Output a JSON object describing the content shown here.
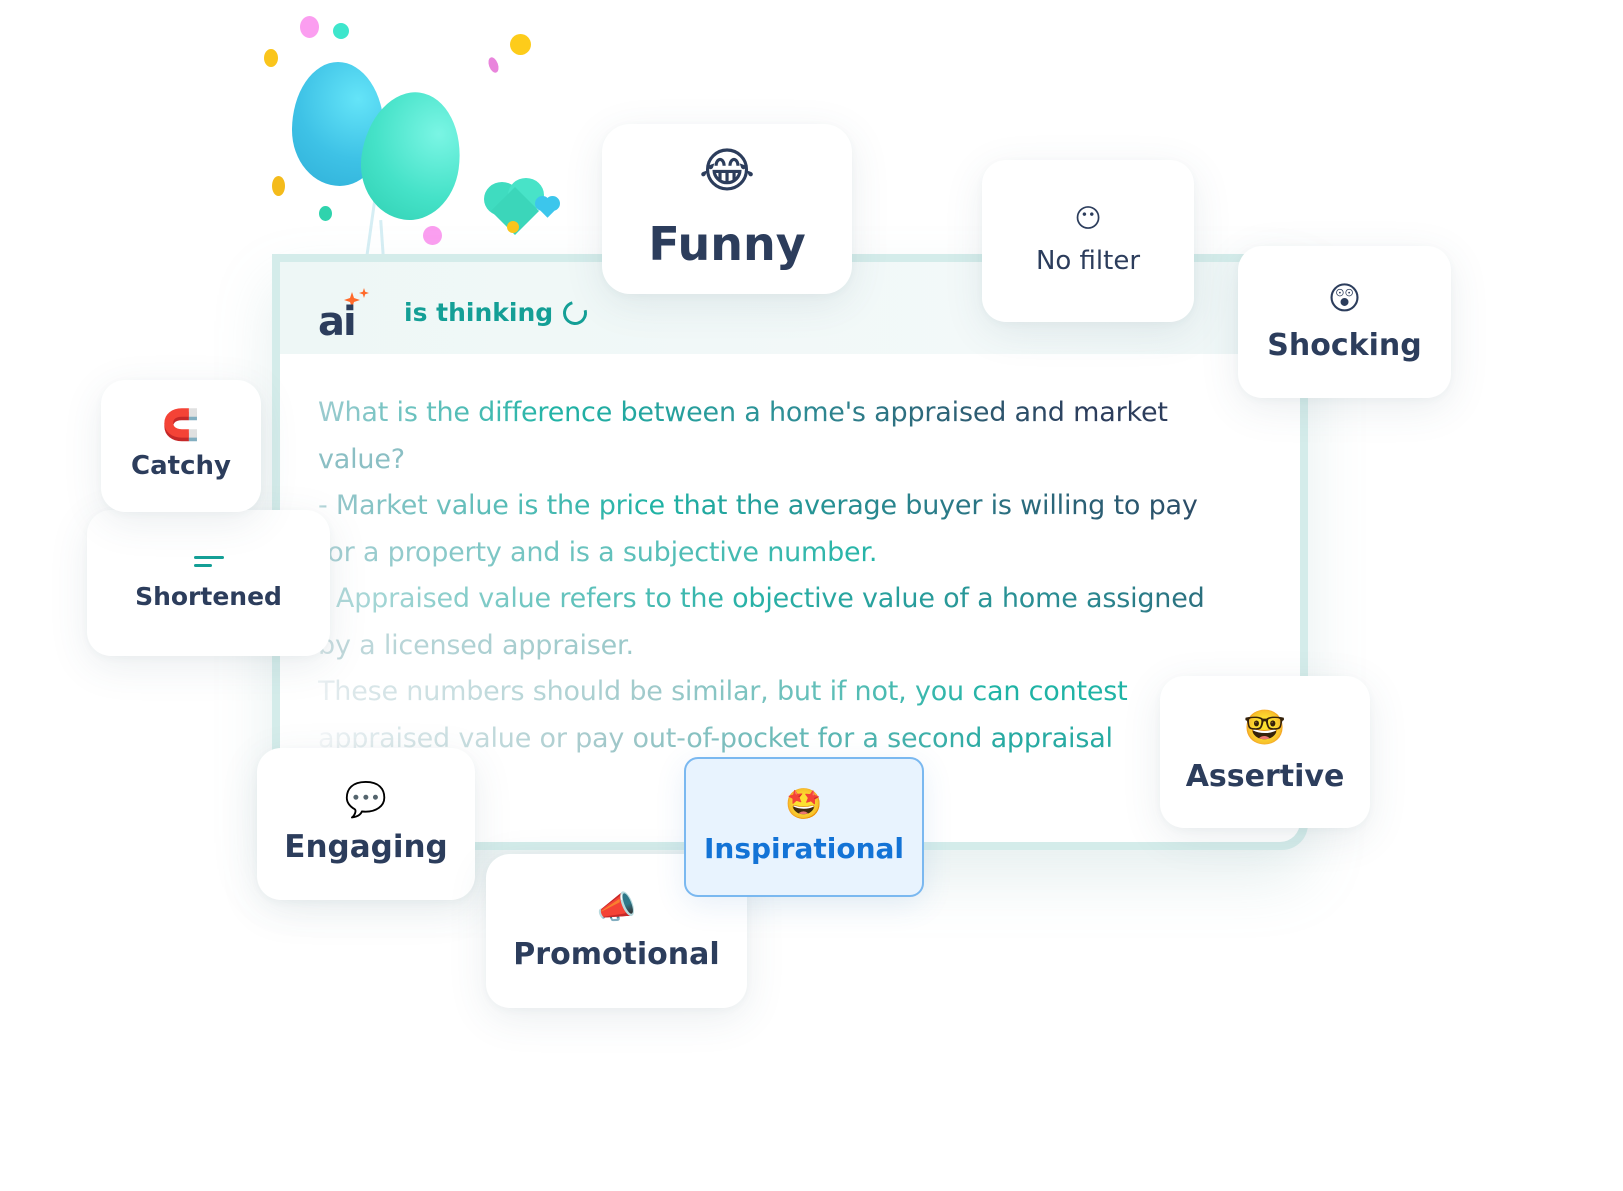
{
  "assistant": {
    "logo_text": "ai",
    "status_text": "is thinking",
    "status_icon": "spinner-icon",
    "response_lines": [
      "What is the difference between a home's appraised and market",
      "value?",
      "- Market value is the price that the average buyer is willing to pay",
      "for a property and is a subjective number.",
      "- Appraised value refers to the objective value of a home assigned",
      "by a licensed appraiser.",
      "These numbers should be similar, but if not, you can contest",
      "appraised value or pay out-of-pocket for a second appraisal"
    ]
  },
  "tones": [
    {
      "id": "funny",
      "label": "Funny",
      "emoji": "😂",
      "icon": "face-with-tears-of-joy-icon",
      "selected": false
    },
    {
      "id": "nofilter",
      "label": "No filter",
      "emoji": "😶",
      "icon": "face-without-mouth-icon",
      "selected": false
    },
    {
      "id": "shocking",
      "label": "Shocking",
      "emoji": "😲",
      "icon": "astonished-face-icon",
      "selected": false
    },
    {
      "id": "catchy",
      "label": "Catchy",
      "emoji": "🧲",
      "icon": "magnet-icon",
      "selected": false
    },
    {
      "id": "shortened",
      "label": "Shortened",
      "emoji": "",
      "icon": "short-lines-icon",
      "selected": false
    },
    {
      "id": "engaging",
      "label": "Engaging",
      "emoji": "💬",
      "icon": "speech-bubble-icon",
      "selected": false
    },
    {
      "id": "inspirational",
      "label": "Inspirational",
      "emoji": "🤩",
      "icon": "star-struck-icon",
      "selected": true
    },
    {
      "id": "promotional",
      "label": "Promotional",
      "emoji": "📣",
      "icon": "megaphone-icon",
      "selected": false
    },
    {
      "id": "assertive",
      "label": "Assertive",
      "emoji": "🤓",
      "icon": "nerd-face-icon",
      "selected": false
    }
  ],
  "colors": {
    "brand_teal": "#149f96",
    "text_navy": "#2c3d5c",
    "selected_blue": "#1373d6",
    "selected_bg": "#e8f3fe",
    "sparkle_orange": "#ff6a2b"
  }
}
